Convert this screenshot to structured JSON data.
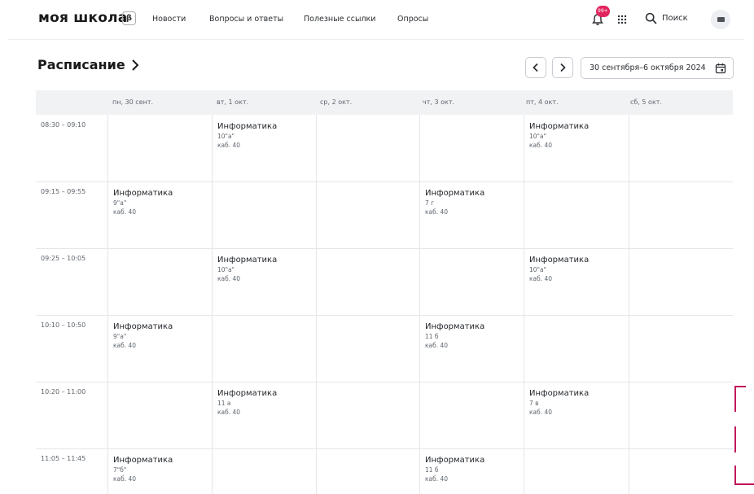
{
  "header": {
    "logo": "моя школа",
    "beta": "β",
    "nav": [
      "Новости",
      "Вопросы и ответы",
      "Полезные ссылки",
      "Опросы"
    ],
    "notifications_badge": "99+",
    "search_label": "Поиск"
  },
  "page": {
    "title": "Расписание",
    "date_range": "30 сентября–6 октября 2024"
  },
  "schedule": {
    "days": [
      "пн, 30 сент.",
      "вт, 1 окт.",
      "ср, 2 окт.",
      "чт, 3 окт.",
      "пт, 4 окт.",
      "сб, 5 окт."
    ],
    "times": [
      "08:30 – 09:10",
      "09:15 – 09:55",
      "09:25 – 10:05",
      "10:10 – 10:50",
      "10:20 – 11:00",
      "11:05 – 11:45"
    ],
    "lessons": [
      {
        "subject": "Информатика",
        "class": "10\"а\"",
        "room": "каб. 40"
      },
      {
        "subject": "Информатика",
        "class": "10\"а\"",
        "room": "каб. 40"
      },
      {
        "subject": "Информатика",
        "class": "9\"а\"",
        "room": "каб. 40"
      },
      {
        "subject": "Информатика",
        "class": "7 г",
        "room": "каб. 40"
      },
      {
        "subject": "Информатика",
        "class": "10\"а\"",
        "room": "каб. 40"
      },
      {
        "subject": "Информатика",
        "class": "10\"а\"",
        "room": "каб. 40"
      },
      {
        "subject": "Информатика",
        "class": "9\"а\"",
        "room": "каб. 40"
      },
      {
        "subject": "Информатика",
        "class": "11 б",
        "room": "каб. 40"
      },
      {
        "subject": "Информатика",
        "class": "11 а",
        "room": "каб. 40"
      },
      {
        "subject": "Информатика",
        "class": "7 в",
        "room": "каб. 40"
      },
      {
        "subject": "Информатика",
        "class": "7\"б\"",
        "room": "каб. 40"
      },
      {
        "subject": "Информатика",
        "class": "11 б",
        "room": "каб. 40"
      }
    ]
  },
  "colors": {
    "accent_badge": "#e0245e",
    "header_bg": "#f1f2f4",
    "grid_line": "#e4e6ea",
    "dash_decoration": "#c2185b"
  },
  "icons": {
    "bell": "bell-icon",
    "apps": "apps-grid-icon",
    "search": "search-icon",
    "calendar": "calendar-icon",
    "prev": "chevron-left-icon",
    "next": "chevron-right-icon"
  }
}
